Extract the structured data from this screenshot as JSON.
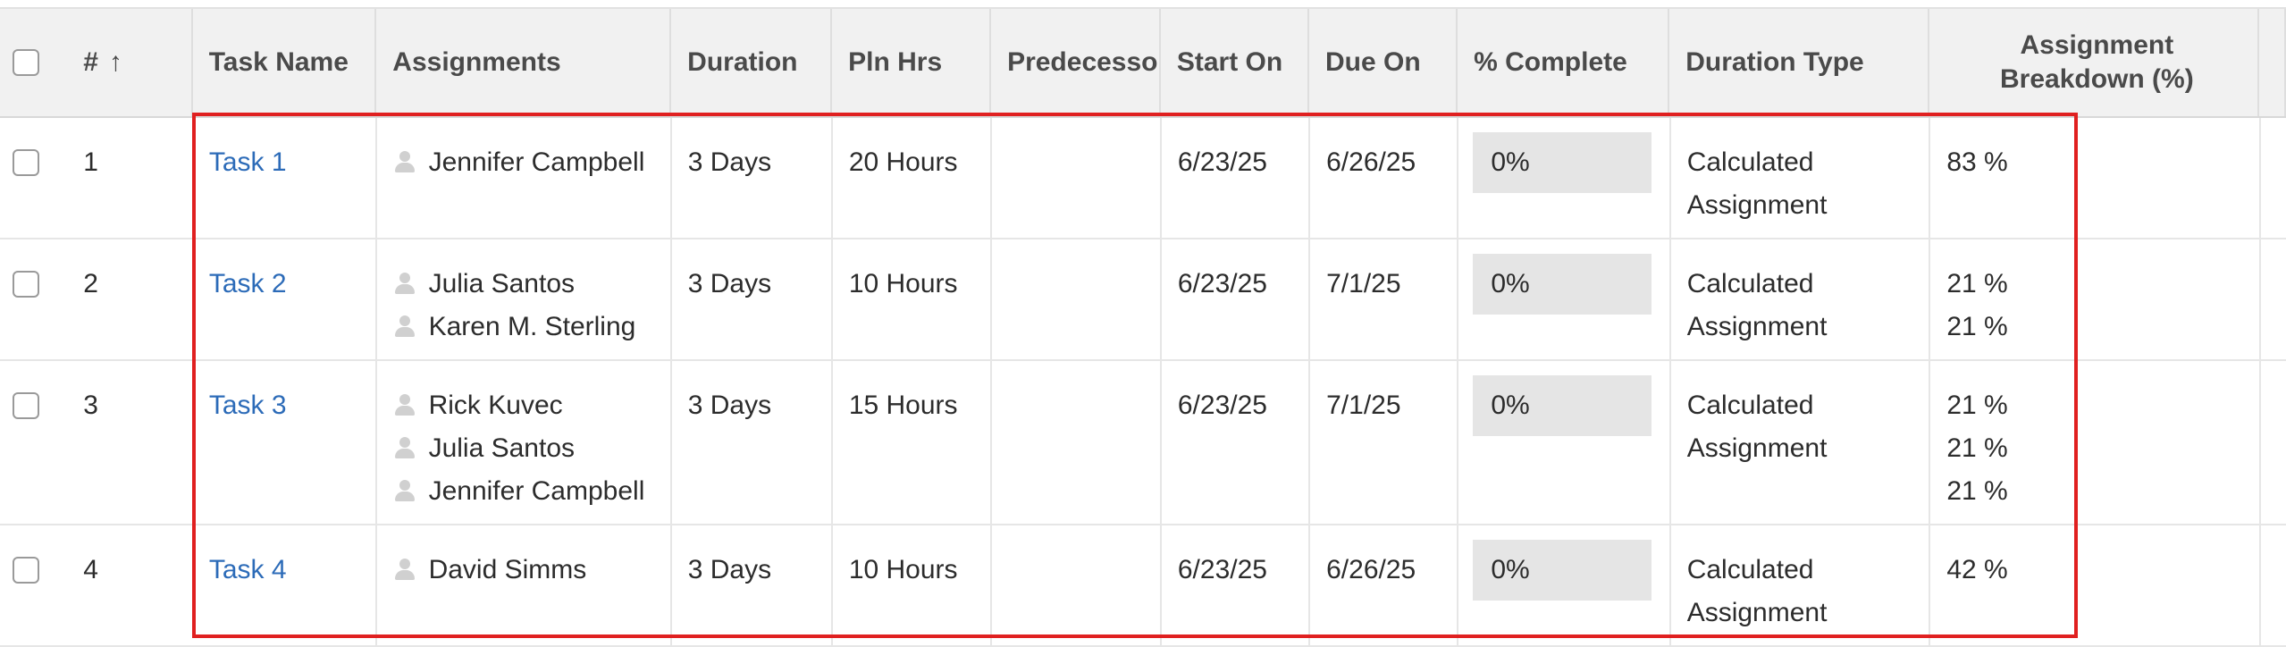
{
  "columns": {
    "number": "#",
    "number_sort_icon": "↑",
    "task_name": "Task Name",
    "assignments": "Assignments",
    "duration": "Duration",
    "pln_hrs": "Pln Hrs",
    "predecessors": "Predecessors",
    "start_on": "Start On",
    "due_on": "Due On",
    "pct_complete": "% Complete",
    "duration_type": "Duration Type",
    "assignment_breakdown": "Assignment Breakdown (%)"
  },
  "rows": [
    {
      "number": "1",
      "task_name": "Task 1",
      "assignments": [
        "Jennifer Campbell"
      ],
      "duration": "3 Days",
      "pln_hrs": "20 Hours",
      "predecessors": "",
      "start_on": "6/23/25",
      "due_on": "6/26/25",
      "pct_complete": "0%",
      "duration_type": [
        "Calculated",
        "Assignment"
      ],
      "breakdown": [
        "83 %"
      ]
    },
    {
      "number": "2",
      "task_name": "Task 2",
      "assignments": [
        "Julia Santos",
        "Karen M. Sterling"
      ],
      "duration": "3 Days",
      "pln_hrs": "10 Hours",
      "predecessors": "",
      "start_on": "6/23/25",
      "due_on": "7/1/25",
      "pct_complete": "0%",
      "duration_type": [
        "Calculated",
        "Assignment"
      ],
      "breakdown": [
        "21 %",
        "21 %"
      ]
    },
    {
      "number": "3",
      "task_name": "Task 3",
      "assignments": [
        "Rick Kuvec",
        "Julia Santos",
        "Jennifer Campbell"
      ],
      "duration": "3 Days",
      "pln_hrs": "15 Hours",
      "predecessors": "",
      "start_on": "6/23/25",
      "due_on": "7/1/25",
      "pct_complete": "0%",
      "duration_type": [
        "Calculated",
        "Assignment"
      ],
      "breakdown": [
        "21 %",
        "21 %",
        "21 %"
      ]
    },
    {
      "number": "4",
      "task_name": "Task 4",
      "assignments": [
        "David Simms"
      ],
      "duration": "3 Days",
      "pln_hrs": "10 Hours",
      "predecessors": "",
      "start_on": "6/23/25",
      "due_on": "6/26/25",
      "pct_complete": "0%",
      "duration_type": [
        "Calculated",
        "Assignment"
      ],
      "breakdown": [
        "42 %"
      ]
    }
  ],
  "colors": {
    "link": "#2c6bb8",
    "highlight_border": "#e02020",
    "header_bg": "#f1f1f1",
    "progress_bg": "#e5e5e5"
  }
}
